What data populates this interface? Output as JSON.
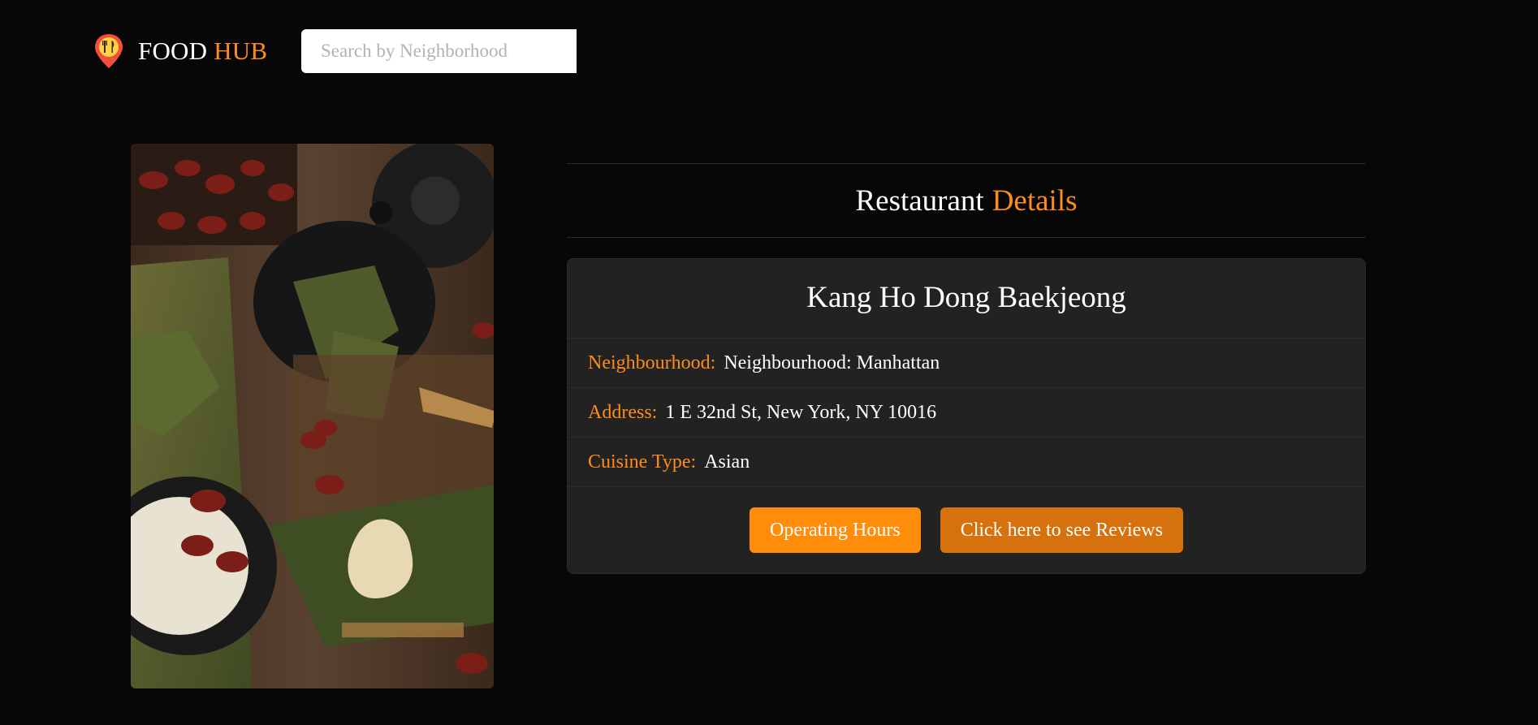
{
  "brand": {
    "name_primary": "FOOD",
    "name_accent": "HUB",
    "icon": "map-pin-cutlery-icon"
  },
  "search": {
    "placeholder": "Search by Neighborhood",
    "value": ""
  },
  "photo": {
    "icon": "food-photo-dumplings"
  },
  "details": {
    "heading_primary": "Restaurant",
    "heading_accent": "Details",
    "restaurant_name": "Kang Ho Dong Baekjeong",
    "fields": [
      {
        "label": "Neighbourhood:",
        "value": "Neighbourhood: Manhattan"
      },
      {
        "label": "Address:",
        "value": "1 E 32nd St, New York, NY 10016"
      },
      {
        "label": "Cuisine Type:",
        "value": "Asian"
      }
    ],
    "buttons": {
      "hours": "Operating Hours",
      "reviews": "Click here to see Reviews"
    }
  },
  "colors": {
    "background": "#070707",
    "accent": "#ff8c1a",
    "card": "#222222",
    "button_hours": "#ff8c0a",
    "button_reviews": "#d5720d"
  }
}
